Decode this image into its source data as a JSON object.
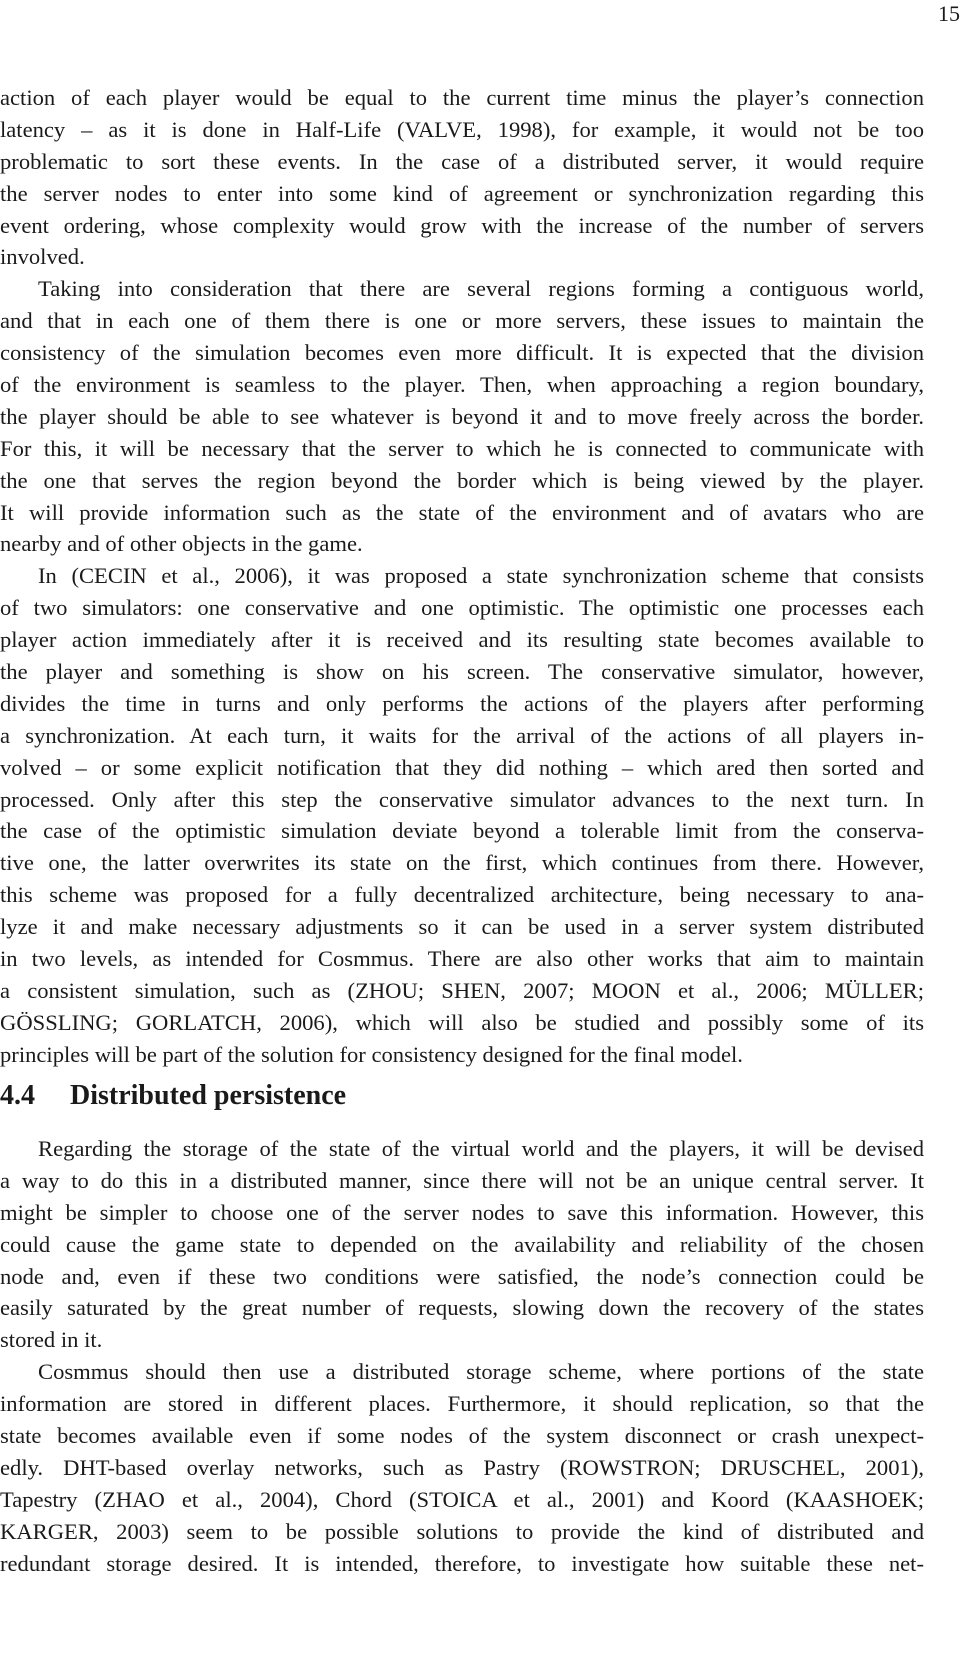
{
  "page_number": "15",
  "block1": {
    "lines": [
      "action of each player would be equal to the current time minus the player’s connection",
      "latency – as it is done in Half-Life (VALVE, 1998), for example, it would not be too",
      "problematic to sort these events.  In the case of a distributed server, it would require",
      "the server nodes to enter into some kind of agreement or synchronization regarding this",
      "event ordering, whose complexity would grow with the increase of the number of servers",
      "involved.",
      "Taking into consideration that there are several regions forming a contiguous world,",
      "and that in each one of them there is one or more servers, these issues to maintain the",
      "consistency of the simulation becomes even more difficult. It is expected that the division",
      "of the environment is seamless to the player. Then, when approaching a region boundary,",
      "the player should be able to see whatever is beyond it and to move freely across the border.",
      "For this, it will be necessary that the server to which he is connected to communicate with",
      "the one that serves the region beyond the border which is being viewed by the player.",
      "It will provide information such as the state of the environment and of avatars who are",
      "nearby and of other objects in the game.",
      "In (CECIN et al., 2006), it was proposed a state synchronization scheme that consists",
      "of two simulators: one conservative and one optimistic. The optimistic one processes each",
      "player action immediately after it is received and its resulting state becomes available to",
      "the player and something is show on his screen.  The conservative simulator, however,",
      "divides the time in turns and only performs the actions of the players after performing",
      "a synchronization.  At each turn, it waits for the arrival of the actions of all players in-",
      "volved – or some explicit notification that they did nothing – which ared then sorted and",
      "processed.  Only after this step the conservative simulator advances to the next turn.  In",
      "the case of the optimistic simulation deviate beyond a tolerable limit from the conserva-",
      "tive one, the latter overwrites its state on the first, which continues from there. However,",
      "this scheme was proposed for a fully decentralized architecture, being necessary to ana-",
      "lyze it and make necessary adjustments so it can be used in a server system distributed",
      "in two levels, as intended for Cosmmus. There are also other works that aim to maintain",
      "a consistent simulation, such as (ZHOU; SHEN, 2007; MOON et al., 2006; MÜLLER;",
      "GÖSSLING; GORLATCH, 2006), which will also be studied and possibly some of its",
      "principles will be part of the solution for consistency designed for the final model."
    ]
  },
  "section": {
    "number": "4.4",
    "title": "Distributed persistence"
  },
  "block2": {
    "lines": [
      "Regarding the storage of the state of the virtual world and the players, it will be devised",
      "a way to do this in a distributed manner, since there will not be an unique central server. It",
      "might be simpler to choose one of the server nodes to save this information. However, this",
      "could cause the game state to depended on the availability and reliability of the chosen",
      "node and, even if these two conditions were satisfied, the node’s connection could be",
      "easily saturated by the great number of requests, slowing down the recovery of the states",
      "stored in it.",
      "Cosmmus should then use a distributed storage scheme, where portions of the state",
      "information are stored in different places. Furthermore, it should replication, so that the",
      "state becomes available even if some nodes of the system disconnect or crash unexpect-",
      "edly. DHT-based overlay networks, such as Pastry (ROWSTRON; DRUSCHEL, 2001),",
      "Tapestry (ZHAO et al., 2004), Chord (STOICA et al., 2001) and Koord (KAASHOEK;",
      "KARGER, 2003) seem to be possible solutions to provide the kind of distributed and",
      "redundant storage desired. It is intended, therefore, to investigate how suitable these net-"
    ]
  }
}
